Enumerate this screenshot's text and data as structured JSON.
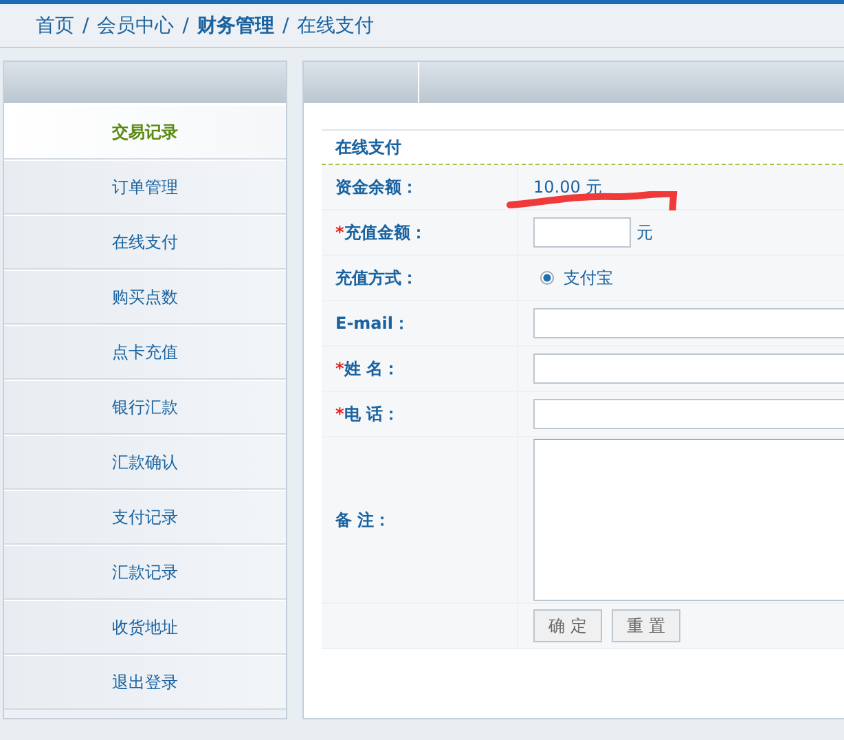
{
  "breadcrumb": [
    {
      "label": "首页",
      "current": false
    },
    {
      "label": "会员中心",
      "current": false
    },
    {
      "label": "财务管理",
      "current": true
    },
    {
      "label": "在线支付",
      "current": false
    }
  ],
  "breadcrumb_separator": "/",
  "sidebar": {
    "items": [
      {
        "label": "交易记录",
        "selected": true
      },
      {
        "label": "订单管理",
        "selected": false
      },
      {
        "label": "在线支付",
        "selected": false
      },
      {
        "label": "购买点数",
        "selected": false
      },
      {
        "label": "点卡充值",
        "selected": false
      },
      {
        "label": "银行汇款",
        "selected": false
      },
      {
        "label": "汇款确认",
        "selected": false
      },
      {
        "label": "支付记录",
        "selected": false
      },
      {
        "label": "汇款记录",
        "selected": false
      },
      {
        "label": "收货地址",
        "selected": false
      },
      {
        "label": "退出登录",
        "selected": false
      }
    ]
  },
  "form": {
    "title": "在线支付",
    "rows": [
      {
        "kind": "text",
        "label": "资金余额：",
        "value": "10.00 元"
      },
      {
        "kind": "amount",
        "label": "充值金额：",
        "required_mark": "*",
        "unit": "元"
      },
      {
        "kind": "radio",
        "label": "充值方式：",
        "options": [
          {
            "label": "支付宝",
            "selected": true
          }
        ]
      },
      {
        "kind": "input",
        "label": "E-mail："
      },
      {
        "kind": "input",
        "label": "姓 名：",
        "required_mark": "*"
      },
      {
        "kind": "input",
        "label": "电 话：",
        "required_mark": "*"
      },
      {
        "kind": "textarea",
        "label": "备 注："
      },
      {
        "kind": "buttons",
        "buttons": [
          "确 定",
          "重 置"
        ]
      }
    ]
  }
}
